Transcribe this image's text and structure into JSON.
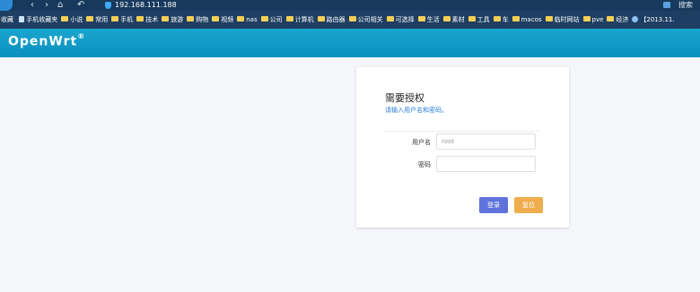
{
  "browser": {
    "nav_back": "‹",
    "nav_forward": "›",
    "nav_home": "⌂",
    "nav_undo": "↶",
    "url": "192.168.111.188",
    "right_label": "搜索"
  },
  "bookmarks": {
    "lead": "收藏",
    "items": [
      {
        "icon": "page",
        "label": "手机收藏夹"
      },
      {
        "icon": "folder",
        "label": "小说"
      },
      {
        "icon": "folder",
        "label": "常用"
      },
      {
        "icon": "folder",
        "label": "手机"
      },
      {
        "icon": "folder",
        "label": "技术"
      },
      {
        "icon": "folder",
        "label": "旅游"
      },
      {
        "icon": "folder",
        "label": "购物"
      },
      {
        "icon": "folder",
        "label": "视频"
      },
      {
        "icon": "folder",
        "label": "nas"
      },
      {
        "icon": "folder",
        "label": "公司"
      },
      {
        "icon": "folder",
        "label": "计算机"
      },
      {
        "icon": "folder",
        "label": "路由器"
      },
      {
        "icon": "folder",
        "label": "公司相关"
      },
      {
        "icon": "folder",
        "label": "可选择"
      },
      {
        "icon": "folder",
        "label": "生活"
      },
      {
        "icon": "folder",
        "label": "素材"
      },
      {
        "icon": "folder",
        "label": "工具"
      },
      {
        "icon": "folder",
        "label": "车"
      },
      {
        "icon": "folder",
        "label": "macos"
      },
      {
        "icon": "folder",
        "label": "临时网站"
      },
      {
        "icon": "folder",
        "label": "pve"
      },
      {
        "icon": "folder",
        "label": "经济"
      },
      {
        "icon": "globe",
        "label": "【2013.11."
      }
    ]
  },
  "app": {
    "brand": "OpenWrt",
    "brand_mark": "®"
  },
  "login": {
    "title": "需要授权",
    "hint": "请输入用户名和密码。",
    "username_label": "用户名",
    "username_placeholder": "root",
    "password_label": "密码",
    "password_placeholder": "",
    "login_button": "登录",
    "reset_button": "复位"
  },
  "colors": {
    "appbar": "#0a9ac6",
    "login_button": "#5f73dc",
    "reset_button": "#f0ad4e",
    "hint": "#2a7fd2"
  }
}
